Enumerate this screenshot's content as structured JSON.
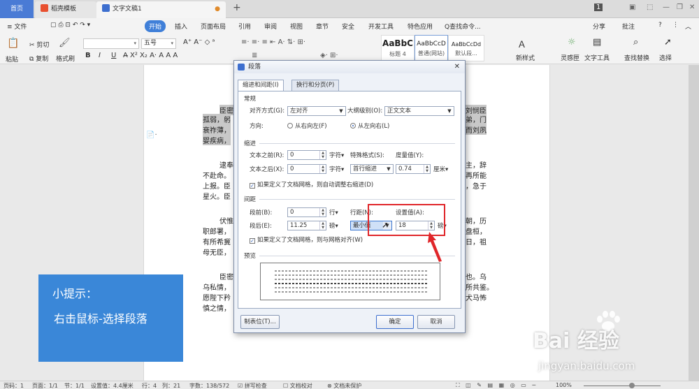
{
  "tabs": {
    "home": "首页",
    "template": "稻壳模板",
    "doc": "文字文稿1",
    "new_tab": "+"
  },
  "window": {
    "badge": "1"
  },
  "menu": {
    "file": "≡ 文件",
    "start": "开始",
    "items": [
      "插入",
      "页面布局",
      "引用",
      "审阅",
      "视图",
      "章节",
      "安全",
      "开发工具",
      "特色应用"
    ],
    "search": "Q查找命令...",
    "share": "分享",
    "annotate": "批注",
    "help": "?"
  },
  "toolbar": {
    "paste": "粘贴",
    "cut": "剪切",
    "copy": "复制",
    "format_painter": "格式刷",
    "font_size": "五号",
    "bold": "B",
    "italic": "I",
    "underline": "U",
    "new_style": "新样式",
    "spirit": "灵感匣",
    "text_tools": "文字工具",
    "find_replace": "查找替换",
    "select": "选择",
    "styles": [
      {
        "sample": "AaBbC",
        "name": "标题 4"
      },
      {
        "sample": "AaBbCcD",
        "name": "普通(网站)"
      },
      {
        "sample": "AaBbCcDd",
        "name": "默认段..."
      }
    ]
  },
  "document": {
    "lines": [
      {
        "text": "臣密",
        "hl": true
      },
      {
        "text": "孤弱，躬",
        "hl": true
      },
      {
        "text": "衰祚薄，",
        "hl": true
      },
      {
        "text": "婴疾病，",
        "hl": true
      },
      {
        "text": "逮奉",
        "hl": false
      },
      {
        "text": "不赴命。",
        "hl": false
      },
      {
        "text": "上报。臣",
        "hl": false
      },
      {
        "text": "星火。臣",
        "hl": false
      },
      {
        "text": "伏惟",
        "hl": false
      },
      {
        "text": "职郎署，",
        "hl": false
      },
      {
        "text": "有所希冀",
        "hl": false
      },
      {
        "text": "母无臣，",
        "hl": false
      },
      {
        "text": "臣密",
        "hl": false
      },
      {
        "text": "乌私情，",
        "hl": false
      },
      {
        "text": "愿陛下矜",
        "hl": false
      },
      {
        "text": "慎之情，",
        "hl": false
      }
    ],
    "right_lines": [
      {
        "text": "刘悯臣",
        "hl": true
      },
      {
        "text": "弟，门",
        "hl": true
      },
      {
        "text": "而刘夙",
        "hl": true
      },
      {
        "text": "",
        "hl": false
      },
      {
        "text": "主，辞",
        "hl": false
      },
      {
        "text": "再所能",
        "hl": false
      },
      {
        "text": "，急于",
        "hl": false
      },
      {
        "text": "",
        "hl": false
      },
      {
        "text": "朝，历",
        "hl": false
      },
      {
        "text": "盘桓，",
        "hl": false
      },
      {
        "text": "日，祖",
        "hl": false
      },
      {
        "text": "",
        "hl": false
      },
      {
        "text": "也。乌",
        "hl": false
      },
      {
        "text": "所共鉴。",
        "hl": false
      },
      {
        "text": "犬马怖",
        "hl": false
      },
      {
        "text": "",
        "hl": false
      }
    ]
  },
  "dialog": {
    "title": "段落",
    "tab_indent": "缩进和间距(I)",
    "tab_line": "换行和分页(P)",
    "general": "常规",
    "align_label": "对齐方式(G):",
    "align_value": "左对齐",
    "outline_label": "大纲级别(O):",
    "outline_value": "正文文本",
    "direction_label": "方向:",
    "rtl": "从右向左(F)",
    "ltr": "从左向右(L)",
    "indent": "缩进",
    "before_text_label": "文本之前(R):",
    "before_text_value": "0",
    "after_text_label": "文本之后(X):",
    "after_text_value": "0",
    "char_unit": "字符▾",
    "special_label": "特殊格式(S):",
    "special_value": "首行缩进",
    "measure_label": "度量值(Y):",
    "measure_value": "0.74",
    "cm_unit": "厘米▾",
    "auto_adjust": "如果定义了文档网格，则自动调整右缩进(D)",
    "spacing": "间距",
    "before_label": "段前(B):",
    "before_value": "0",
    "line_unit": "行▾",
    "after_label": "段后(E):",
    "after_value": "11.25",
    "pound_unit": "磅▾",
    "line_spacing_label": "行距(N):",
    "line_spacing_value": "最小值",
    "setting_label": "设置值(A):",
    "setting_value": "18",
    "setting_unit": "磅▾",
    "grid_align": "如果定义了文档网格，则与网格对齐(W)",
    "preview": "预览",
    "tabs_btn": "制表位(T)...",
    "ok": "确定",
    "cancel": "取消"
  },
  "tip": {
    "title": "小提示：",
    "text": "右击鼠标-选择段落"
  },
  "watermark": {
    "logo": "Bai 经验",
    "url": "jingyan.baidu.com"
  },
  "status": {
    "page_num": "页码：1",
    "pages": "页面：1/1",
    "section": "节：1/1",
    "setting": "设置值：4.4厘米",
    "row": "行：4",
    "col": "列：21",
    "words": "字数：138/572",
    "spell": "拼写检查",
    "proof": "文档校对",
    "unprotected": "文档未保护",
    "zoom": "100%"
  },
  "colors": {
    "accent": "#3a87d8",
    "highlight_box": "#e0262a"
  }
}
